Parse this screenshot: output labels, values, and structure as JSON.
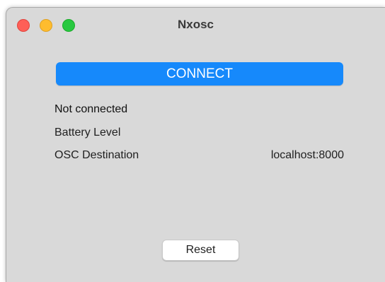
{
  "window": {
    "title": "Nxosc"
  },
  "controls": {
    "connect_label": "CONNECT",
    "reset_label": "Reset"
  },
  "status": {
    "connection_text": "Not connected",
    "battery_label": "Battery Level",
    "osc_label": "OSC Destination",
    "osc_value": "localhost:8000"
  },
  "colors": {
    "accent": "#1689fb",
    "window_bg": "#d9d9d9",
    "close": "#fe5f57",
    "minimize": "#febc2e",
    "zoom": "#28c840"
  }
}
